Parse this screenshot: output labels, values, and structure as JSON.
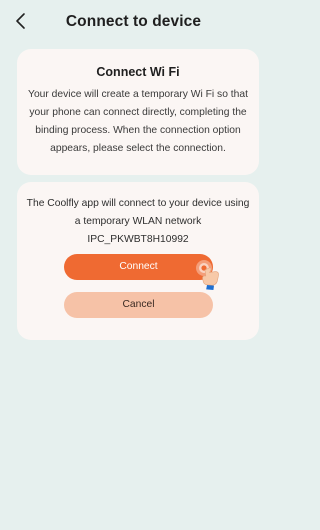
{
  "header": {
    "title": "Connect to device",
    "back_icon": "chevron-left-icon"
  },
  "info_card": {
    "title": "Connect Wi Fi",
    "description": "Your device will create a temporary Wi Fi so that your phone can connect directly, completing the binding process. When the connection option appears, please select the connection."
  },
  "connect_card": {
    "line1": "The Coolfly app will connect to your device using",
    "line2": "a temporary WLAN network",
    "network_name": "IPC_PKWBT8H10992",
    "connect_label": "Connect",
    "cancel_label": "Cancel",
    "tap_hint_icon": "tap-hand-icon"
  },
  "colors": {
    "background": "#e6f0ee",
    "card": "#fbf6f4",
    "primary_button": "#ef6a32",
    "secondary_button": "#f6c2a7"
  }
}
